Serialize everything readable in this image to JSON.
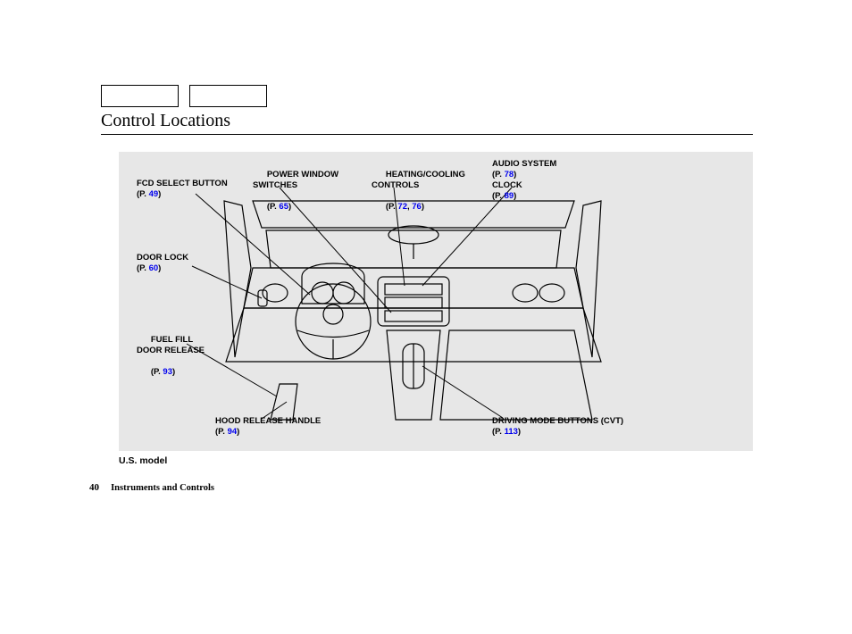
{
  "section_title": "Control Locations",
  "page_number": "40",
  "footer_section": "Instruments and Controls",
  "model_note": "U.S. model",
  "p_label": "(P. ",
  "p_close": ")",
  "callouts": {
    "fcd": {
      "label": "FCD SELECT BUTTON",
      "pages": [
        "49"
      ]
    },
    "pws": {
      "label": "POWER WINDOW\nSWITCHES",
      "pages": [
        "65"
      ]
    },
    "hcc": {
      "label": "HEATING/COOLING\nCONTROLS",
      "pages": [
        "72",
        "76"
      ]
    },
    "audio": {
      "line1": "AUDIO SYSTEM",
      "pages1": [
        "78"
      ],
      "line2": "CLOCK",
      "pages2": [
        "89"
      ]
    },
    "doorlock": {
      "label": "DOOR LOCK",
      "pages": [
        "60"
      ]
    },
    "fuel": {
      "label": "FUEL FILL\nDOOR RELEASE",
      "pages": [
        "93"
      ]
    },
    "hood": {
      "label": "HOOD RELEASE HANDLE",
      "pages": [
        "94"
      ]
    },
    "drive": {
      "label": "DRIVING MODE BUTTONS (CVT)",
      "pages": [
        "113"
      ]
    }
  }
}
